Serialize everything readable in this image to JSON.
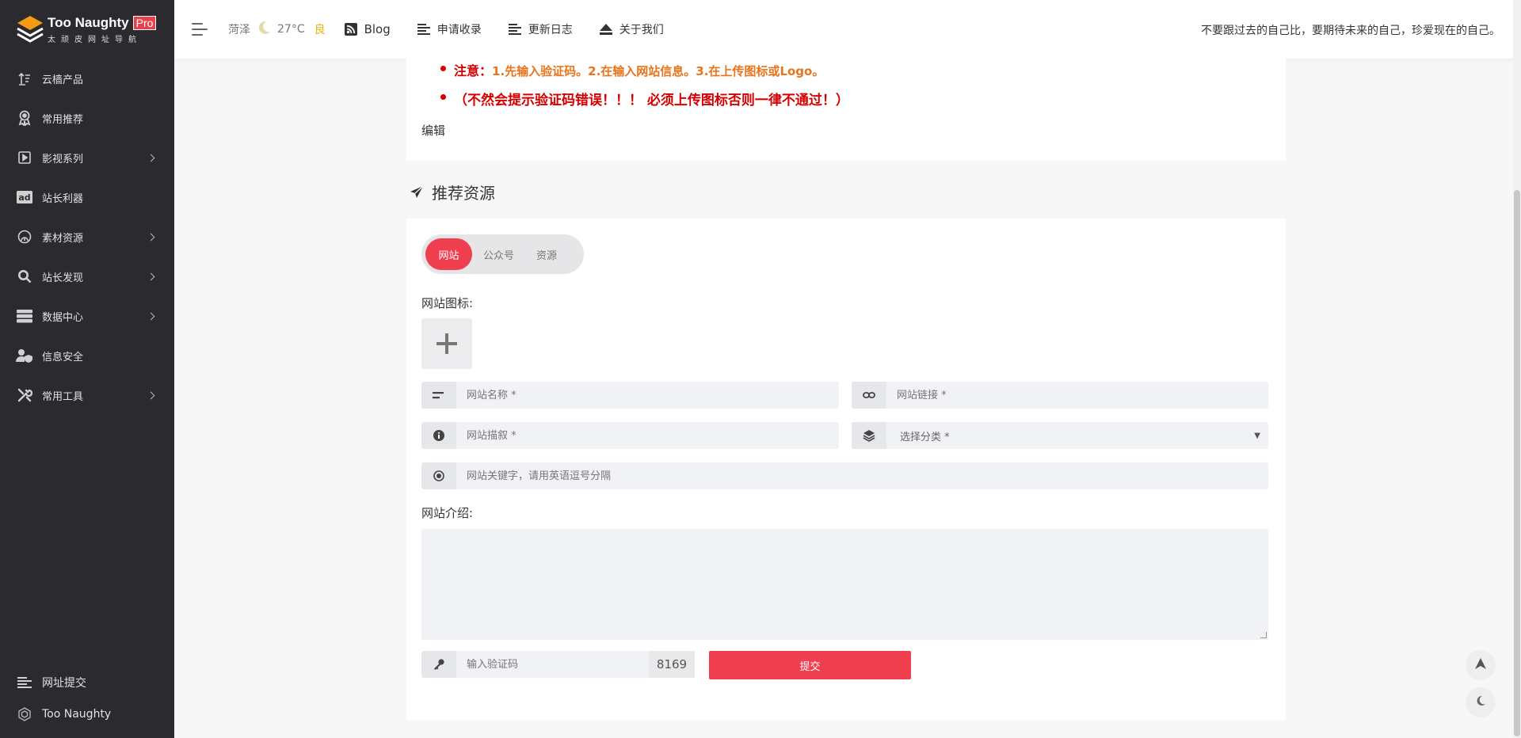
{
  "brand": {
    "title": "Too Naughty",
    "badge": "Pro",
    "subtitle": "太顽皮网址导航",
    "colors": {
      "accent": "#ef3e4e",
      "sidebar": "#2b2b2f"
    }
  },
  "sidebar": {
    "items": [
      {
        "label": "云樯产品",
        "icon": "sort-up-icon",
        "has_arrow": false
      },
      {
        "label": "常用推荐",
        "icon": "award-icon",
        "has_arrow": false
      },
      {
        "label": "影视系列",
        "icon": "play-square-icon",
        "has_arrow": true
      },
      {
        "label": "站长利器",
        "icon": "ad-icon",
        "has_arrow": false
      },
      {
        "label": "素材资源",
        "icon": "rainbow-icon",
        "has_arrow": true
      },
      {
        "label": "站长发现",
        "icon": "search-icon",
        "has_arrow": true
      },
      {
        "label": "数据中心",
        "icon": "server-icon",
        "has_arrow": true
      },
      {
        "label": "信息安全",
        "icon": "user-shield-icon",
        "has_arrow": false
      },
      {
        "label": "常用工具",
        "icon": "tools-icon",
        "has_arrow": true
      }
    ],
    "bottom": [
      {
        "label": "网址提交",
        "icon": "list-icon"
      },
      {
        "label": "Too Naughty",
        "icon": "globe-icon"
      }
    ]
  },
  "header": {
    "weather": {
      "city": "菏泽",
      "temp": "27°C",
      "aqi": "良",
      "icon": "moon-icon"
    },
    "nav": [
      {
        "label": "Blog",
        "icon": "rss-icon"
      },
      {
        "label": "申请收录",
        "icon": "align-left-icon"
      },
      {
        "label": "更新日志",
        "icon": "align-left-icon"
      },
      {
        "label": "关于我们",
        "icon": "eject-icon"
      }
    ],
    "motto": "不要跟过去的自己比，要期待未来的自己，珍爱现在的自己。"
  },
  "notice": {
    "note_prefix": "注意：",
    "note_text": "1.先输入验证码。2.在输入网站信息。3.在上传图标或Logo。",
    "warning": "（不然会提示验证码错误！！！ 必须上传图标否则一律不通过！）",
    "edit": "编辑"
  },
  "section": {
    "title": "推荐资源",
    "icon": "paper-plane-icon"
  },
  "form": {
    "tabs": [
      "网站",
      "公众号",
      "资源"
    ],
    "active_tab": "网站",
    "icon_label": "网站图标:",
    "name_placeholder": "网站名称 *",
    "link_placeholder": "网站链接 *",
    "desc_placeholder": "网站描叙 *",
    "category": "选择分类 *",
    "keywords_placeholder": "网站关键字，请用英语逗号分隔",
    "intro_label": "网站介绍:",
    "captcha_placeholder": "输入验证码",
    "captcha_code": "8169",
    "submit": "提交"
  }
}
